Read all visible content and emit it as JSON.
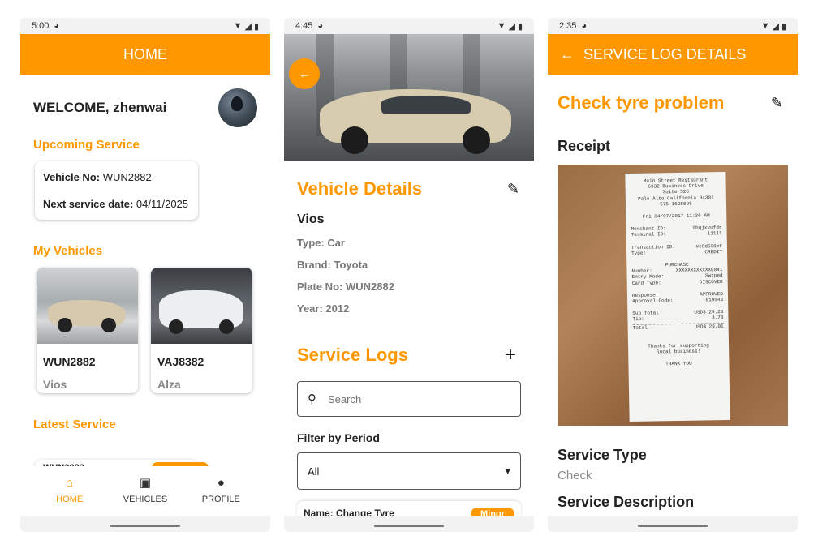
{
  "colors": {
    "accent": "#ff9800",
    "text": "#222222",
    "muted": "#888888"
  },
  "phone1": {
    "status": {
      "time": "5:00"
    },
    "appbar_title": "HOME",
    "welcome": "WELCOME, zhenwai",
    "upcoming": {
      "title": "Upcoming Service",
      "vehicle_label": "Vehicle No:",
      "vehicle_value": "WUN2882",
      "date_label": "Next service date:",
      "date_value": "04/11/2025"
    },
    "my_vehicles": {
      "title": "My Vehicles",
      "items": [
        {
          "plate": "WUN2882",
          "model": "Vios"
        },
        {
          "plate": "VAJ8382",
          "model": "Alza"
        }
      ]
    },
    "latest_service": {
      "title": "Latest Service",
      "row_partial": "WUN2882"
    },
    "nav": [
      {
        "label": "HOME",
        "icon": "home-icon"
      },
      {
        "label": "VEHICLES",
        "icon": "car-icon"
      },
      {
        "label": "PROFILE",
        "icon": "person-icon"
      }
    ]
  },
  "phone2": {
    "status": {
      "time": "4:45"
    },
    "vehicle_details": {
      "title": "Vehicle Details",
      "name": "Vios",
      "type": "Type: Car",
      "brand": "Brand: Toyota",
      "plate": "Plate No: WUN2882",
      "year": "Year: 2012"
    },
    "service_logs": {
      "title": "Service Logs",
      "search_placeholder": "Search",
      "filter_label": "Filter by Period",
      "filter_value": "All",
      "first_log_name": "Name: Change Tyre",
      "first_log_badge": "Minor"
    }
  },
  "phone3": {
    "status": {
      "time": "2:35"
    },
    "appbar_title": "SERVICE LOG DETAILS",
    "log_title": "Check tyre problem",
    "receipt_label": "Receipt",
    "receipt": {
      "header": [
        "Main Street Restaurant",
        "6332 Business Drive",
        "Suite 528",
        "Palo Alto California 94301",
        "575-1628095"
      ],
      "datetime": "Fri 04/07/2017 11:36 AM",
      "merchant_id_label": "Merchant ID:",
      "merchant_id": "9hqjxvufdr",
      "terminal_id_label": "Terminal ID:",
      "terminal_id": "11111",
      "transaction_id_label": "Transaction ID:",
      "transaction_id": "#e6d598ef",
      "type_label": "Type:",
      "type": "CREDIT",
      "purchase": "PURCHASE",
      "number_label": "Number:",
      "number": "XXXXXXXXXXXX0041",
      "entry_label": "Entry Mode:",
      "entry": "Swiped",
      "card_label": "Card Type:",
      "card": "DISCOVER",
      "response_label": "Response:",
      "response": "APPROVED",
      "approval_label": "Approval Code:",
      "approval": "819543",
      "subtotal_label": "Sub Total",
      "subtotal": "USD$ 25.23",
      "tip_label": "Tip:",
      "tip": "3.78",
      "total_label": "Total",
      "total": "USD$ 29.01",
      "thanks_1": "Thanks for supporting",
      "thanks_2": "local business!",
      "thanks_3": "THANK YOU"
    },
    "service_type_label": "Service Type",
    "service_type_value": "Check",
    "service_description_label": "Service Description"
  }
}
